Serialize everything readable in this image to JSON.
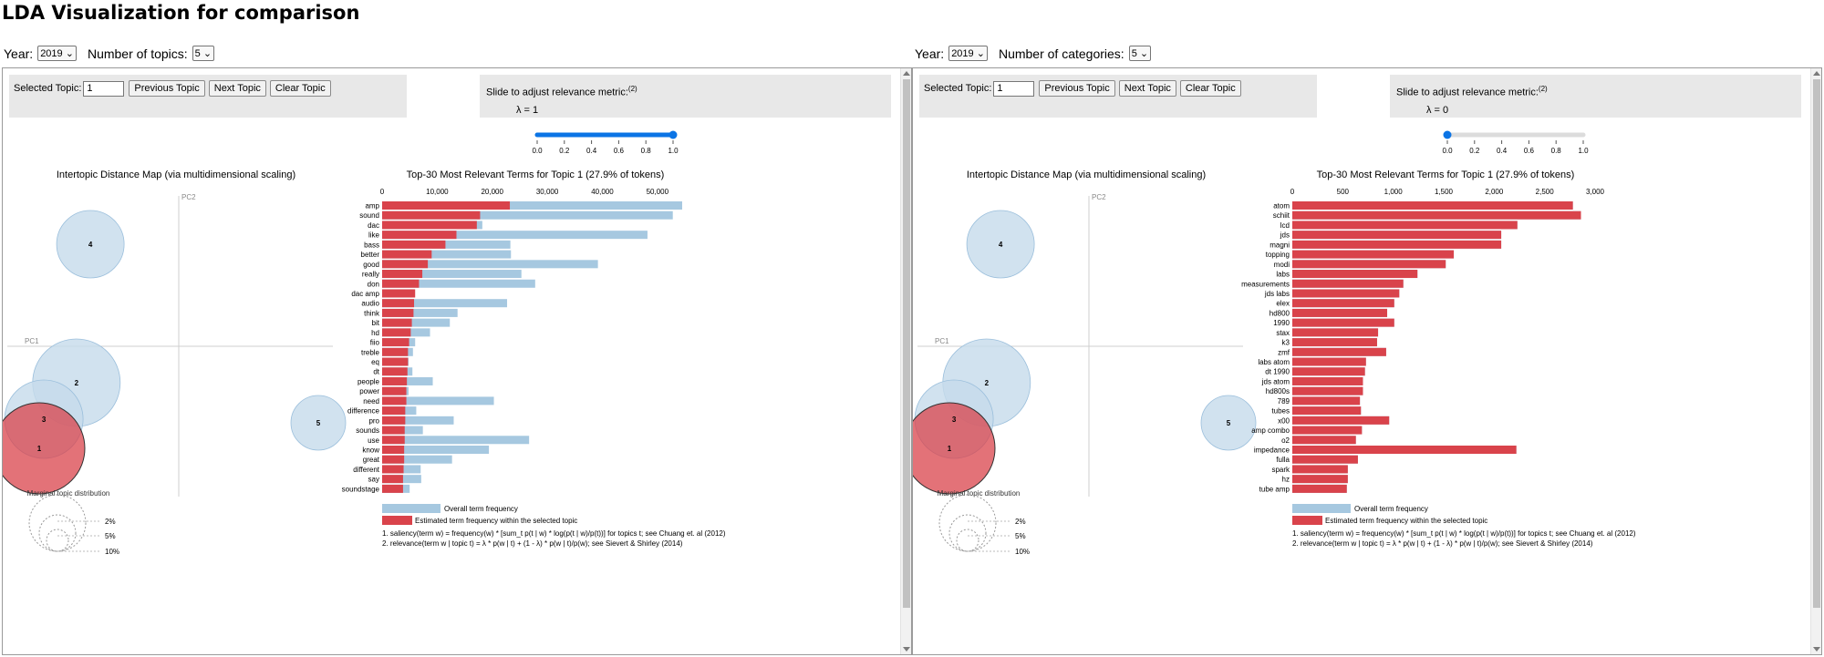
{
  "page_title": "LDA Visualization for comparison",
  "left": {
    "year_label": "Year:",
    "year_value": "2019",
    "count_label": "Number of topics:",
    "count_value": "5",
    "selected_topic_label": "Selected Topic:",
    "selected_topic_value": "1",
    "prev_label": "Previous Topic",
    "next_label": "Next Topic",
    "clear_label": "Clear Topic",
    "slider_label": "Slide to adjust relevance metric:",
    "slider_note": "(2)",
    "lambda_text": "λ = 1",
    "lambda": 1,
    "slider_ticks": [
      "0.0",
      "0.2",
      "0.4",
      "0.6",
      "0.8",
      "1.0"
    ],
    "map_title": "Intertopic Distance Map (via multidimensional scaling)",
    "pc1": "PC1",
    "pc2": "PC2",
    "marginal_title": "Marginal topic distribution",
    "marginal_labels": [
      "2%",
      "5%",
      "10%"
    ],
    "bar_title": "Top-30 Most Relevant Terms for Topic 1 (27.9% of tokens)",
    "legend_overall": "Overall term frequency",
    "legend_estimated": "Estimated term frequency within the selected topic",
    "footnote_1": "1. saliency(term w) = frequency(w) * [sum_t p(t | w) * log(p(t | w)/p(t))] for topics t; see Chuang et. al (2012)",
    "footnote_2": "2. relevance(term w | topic t) = λ * p(w | t) + (1 - λ) * p(w | t)/p(w); see Sievert & Shirley (2014)"
  },
  "right": {
    "year_label": "Year:",
    "year_value": "2019",
    "count_label": "Number of categories:",
    "count_value": "5",
    "selected_topic_label": "Selected Topic:",
    "selected_topic_value": "1",
    "prev_label": "Previous Topic",
    "next_label": "Next Topic",
    "clear_label": "Clear Topic",
    "slider_label": "Slide to adjust relevance metric:",
    "slider_note": "(2)",
    "lambda_text": "λ = 0",
    "lambda": 0,
    "slider_ticks": [
      "0.0",
      "0.2",
      "0.4",
      "0.6",
      "0.8",
      "1.0"
    ],
    "map_title": "Intertopic Distance Map (via multidimensional scaling)",
    "pc1": "PC1",
    "pc2": "PC2",
    "marginal_title": "Marginal topic distribution",
    "marginal_labels": [
      "2%",
      "5%",
      "10%"
    ],
    "bar_title": "Top-30 Most Relevant Terms for Topic 1 (27.9% of tokens)",
    "legend_overall": "Overall term frequency",
    "legend_estimated": "Estimated term frequency within the selected topic",
    "footnote_1": "1. saliency(term w) = frequency(w) * [sum_t p(t | w) * log(p(t | w)/p(t))] for topics t; see Chuang et. al (2012)",
    "footnote_2": "2. relevance(term w | topic t) = λ * p(w | t) + (1 - λ) * p(w | t)/p(w); see Sievert & Shirley (2014)"
  },
  "colors": {
    "overall": "#a6c8e0",
    "estimated": "#d9434b",
    "topic_bubble": "#c6dbeb",
    "selected_bubble": "#d9434b",
    "panel_bg": "#e8e8e8",
    "slider_blue": "#0b74e5"
  },
  "chart_data": [
    {
      "type": "bar",
      "title": "Top-30 Most Relevant Terms for Topic 1 (27.9% of tokens)",
      "orientation": "horizontal",
      "xlim": [
        0,
        55000
      ],
      "xticks": [
        0,
        10000,
        20000,
        30000,
        40000,
        50000
      ],
      "xtick_labels": [
        "0",
        "10,000",
        "20,000",
        "30,000",
        "40,000",
        "50,000"
      ],
      "categories": [
        "amp",
        "sound",
        "dac",
        "like",
        "bass",
        "better",
        "good",
        "really",
        "don",
        "dac amp",
        "audio",
        "think",
        "bit",
        "hd",
        "fiio",
        "treble",
        "eq",
        "dt",
        "people",
        "power",
        "need",
        "difference",
        "pro",
        "sounds",
        "use",
        "know",
        "great",
        "different",
        "say",
        "soundstage"
      ],
      "series": [
        {
          "name": "Overall term frequency",
          "values": [
            54500,
            52800,
            18200,
            48200,
            23300,
            23400,
            39200,
            25300,
            27800,
            5500,
            22700,
            13700,
            12300,
            8700,
            6000,
            5600,
            4800,
            5500,
            9200,
            4800,
            20300,
            6200,
            13000,
            7400,
            26700,
            19400,
            12700,
            7000,
            7100,
            5000
          ]
        },
        {
          "name": "Estimated term frequency within the selected topic",
          "values": [
            23200,
            17800,
            17200,
            13500,
            11500,
            9000,
            8300,
            7300,
            6700,
            6000,
            5800,
            5700,
            5400,
            5200,
            4900,
            4700,
            4700,
            4600,
            4500,
            4400,
            4400,
            4200,
            4200,
            4100,
            4100,
            4000,
            4000,
            3900,
            3800,
            3800
          ]
        }
      ],
      "legend": [
        "Overall term frequency",
        "Estimated term frequency within the selected topic"
      ],
      "topics": [
        {
          "label": "1",
          "pc1": -0.3,
          "pc2": -0.28,
          "radius": 50,
          "selected": true
        },
        {
          "label": "2",
          "pc1": -0.22,
          "pc2": -0.1,
          "radius": 48,
          "selected": false
        },
        {
          "label": "3",
          "pc1": -0.29,
          "pc2": -0.2,
          "radius": 43,
          "selected": false
        },
        {
          "label": "4",
          "pc1": -0.19,
          "pc2": 0.28,
          "radius": 37,
          "selected": false
        },
        {
          "label": "5",
          "pc1": 0.3,
          "pc2": -0.21,
          "radius": 30,
          "selected": false
        }
      ]
    },
    {
      "type": "bar",
      "title": "Top-30 Most Relevant Terms for Topic 1 (27.9% of tokens)",
      "orientation": "horizontal",
      "xlim": [
        0,
        3000
      ],
      "xticks": [
        0,
        500,
        1000,
        1500,
        2000,
        2500,
        3000
      ],
      "xtick_labels": [
        "0",
        "500",
        "1,000",
        "1,500",
        "2,000",
        "2,500",
        "3,000"
      ],
      "categories": [
        "atom",
        "schiit",
        "lcd",
        "jds",
        "magni",
        "topping",
        "modi",
        "labs",
        "measurements",
        "jds labs",
        "elex",
        "hd800",
        "1990",
        "stax",
        "k3",
        "zmf",
        "labs atom",
        "dt 1990",
        "jds atom",
        "hd800s",
        "789",
        "tubes",
        "x00",
        "amp combo",
        "o2",
        "impedance",
        "fulla",
        "spark",
        "hz",
        "tube amp"
      ],
      "series": [
        {
          "name": "Overall term frequency",
          "values": [
            2780,
            2860,
            2230,
            2070,
            2070,
            1600,
            1520,
            1240,
            1100,
            1060,
            1010,
            940,
            1010,
            850,
            840,
            930,
            730,
            720,
            700,
            700,
            670,
            680,
            960,
            690,
            630,
            2220,
            650,
            550,
            550,
            540
          ]
        },
        {
          "name": "Estimated term frequency within the selected topic",
          "values": [
            2780,
            2860,
            2230,
            2070,
            2070,
            1600,
            1520,
            1240,
            1100,
            1060,
            1010,
            940,
            1010,
            850,
            840,
            930,
            730,
            720,
            700,
            700,
            670,
            680,
            960,
            690,
            630,
            2220,
            650,
            550,
            550,
            540
          ]
        }
      ],
      "legend": [
        "Overall term frequency",
        "Estimated term frequency within the selected topic"
      ],
      "topics": [
        {
          "label": "1",
          "pc1": -0.3,
          "pc2": -0.28,
          "radius": 50,
          "selected": true
        },
        {
          "label": "2",
          "pc1": -0.22,
          "pc2": -0.1,
          "radius": 48,
          "selected": false
        },
        {
          "label": "3",
          "pc1": -0.29,
          "pc2": -0.2,
          "radius": 43,
          "selected": false
        },
        {
          "label": "4",
          "pc1": -0.19,
          "pc2": 0.28,
          "radius": 37,
          "selected": false
        },
        {
          "label": "5",
          "pc1": 0.3,
          "pc2": -0.21,
          "radius": 30,
          "selected": false
        }
      ]
    }
  ]
}
